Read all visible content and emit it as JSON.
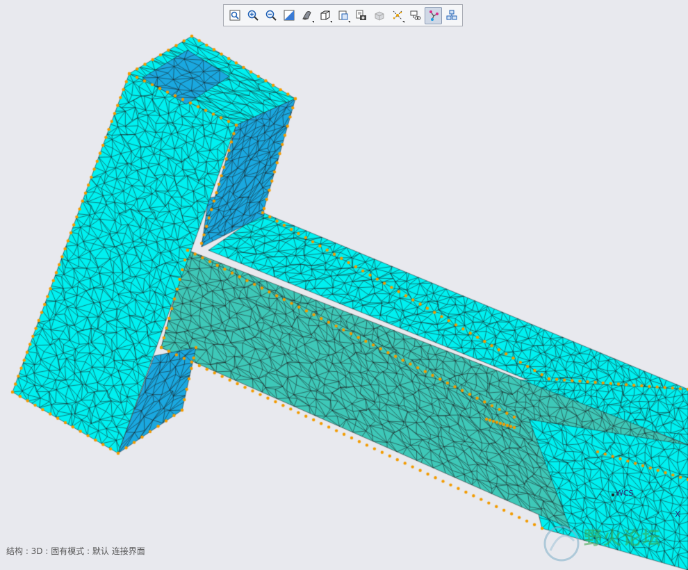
{
  "toolbar": {
    "buttons": [
      {
        "name": "refit-icon",
        "active": false
      },
      {
        "name": "zoom-in-icon",
        "active": false
      },
      {
        "name": "zoom-out-icon",
        "active": false
      },
      {
        "name": "repaint-icon",
        "active": false
      },
      {
        "name": "display-style-icon",
        "active": false,
        "menu": true
      },
      {
        "name": "saved-orientations-icon",
        "active": false,
        "menu": true
      },
      {
        "name": "view-manager-icon",
        "active": false,
        "menu": true
      },
      {
        "name": "snapshot-icon",
        "active": false
      },
      {
        "name": "appearance-icon",
        "active": false
      },
      {
        "name": "datum-display-icon",
        "active": false,
        "menu": true
      },
      {
        "name": "annotation-display-icon",
        "active": false
      },
      {
        "name": "mesh-connection-icon",
        "active": true
      },
      {
        "name": "model-tree-filter-icon",
        "active": false
      }
    ]
  },
  "status": {
    "text": "结构 : 3D : 固有模式 : 默认 连接界面"
  },
  "viewport": {
    "wcs_label": "WCS",
    "x_axis_label": "X",
    "watermark_text": "野火论坛"
  },
  "colors": {
    "background": "#e8e9ee",
    "mesh_face": "#00f0f0",
    "mesh_shadow_face": "#3ec8b8",
    "mesh_inner_face": "#1aa8e0",
    "mesh_edge": "#1a1a1a",
    "mesh_node": "#f29b00"
  }
}
